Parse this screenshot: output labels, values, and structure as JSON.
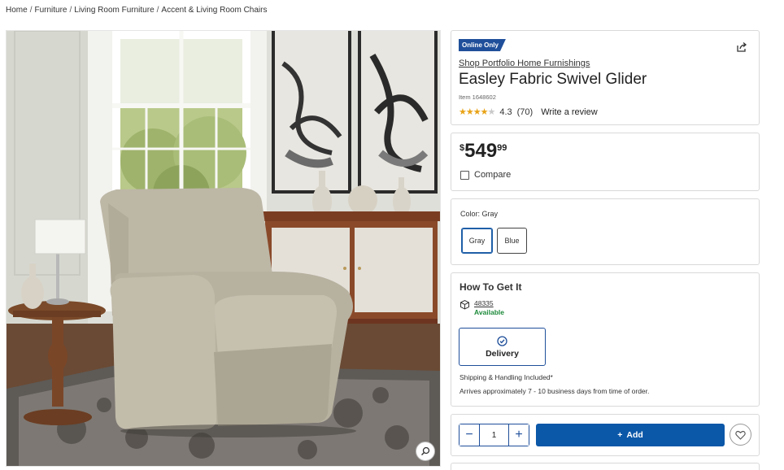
{
  "breadcrumb": [
    "Home",
    "Furniture",
    "Living Room Furniture",
    "Accent & Living Room Chairs"
  ],
  "breadcrumb_sep": "/",
  "product": {
    "badge": "Online Only",
    "brand": "Shop Portfolio Home Furnishings",
    "title": "Easley Fabric Swivel Glider",
    "item_number": "Item 1648602",
    "rating_value": "4.3",
    "rating_stars": 4.3,
    "review_count": "(70)",
    "write_review": "Write a review",
    "icons": {
      "share": "share-icon",
      "zoom": "zoom-icon",
      "heart": "heart-icon",
      "box": "box-icon",
      "check": "check-circle-icon"
    }
  },
  "price": {
    "currency": "$",
    "dollars": "549",
    "cents": "99"
  },
  "compare_label": "Compare",
  "color": {
    "label": "Color: Gray",
    "options": [
      "Gray",
      "Blue"
    ],
    "selected": "Gray"
  },
  "how_to_get": {
    "title": "How To Get It",
    "zip": "48335",
    "availability": "Available",
    "delivery_label": "Delivery",
    "shipping_note": "Shipping & Handling Included*",
    "arrival_note": "Arrives approximately 7 - 10 business days from time of order."
  },
  "cart": {
    "quantity": "1",
    "add_label": "Add",
    "minus_symbol": "−",
    "plus_symbol": "+",
    "add_symbol": "+"
  },
  "colors": {
    "accent": "#0b57a8",
    "badge": "#1f4f9a",
    "available": "#1d8a3a",
    "stars": "#e8a317"
  }
}
